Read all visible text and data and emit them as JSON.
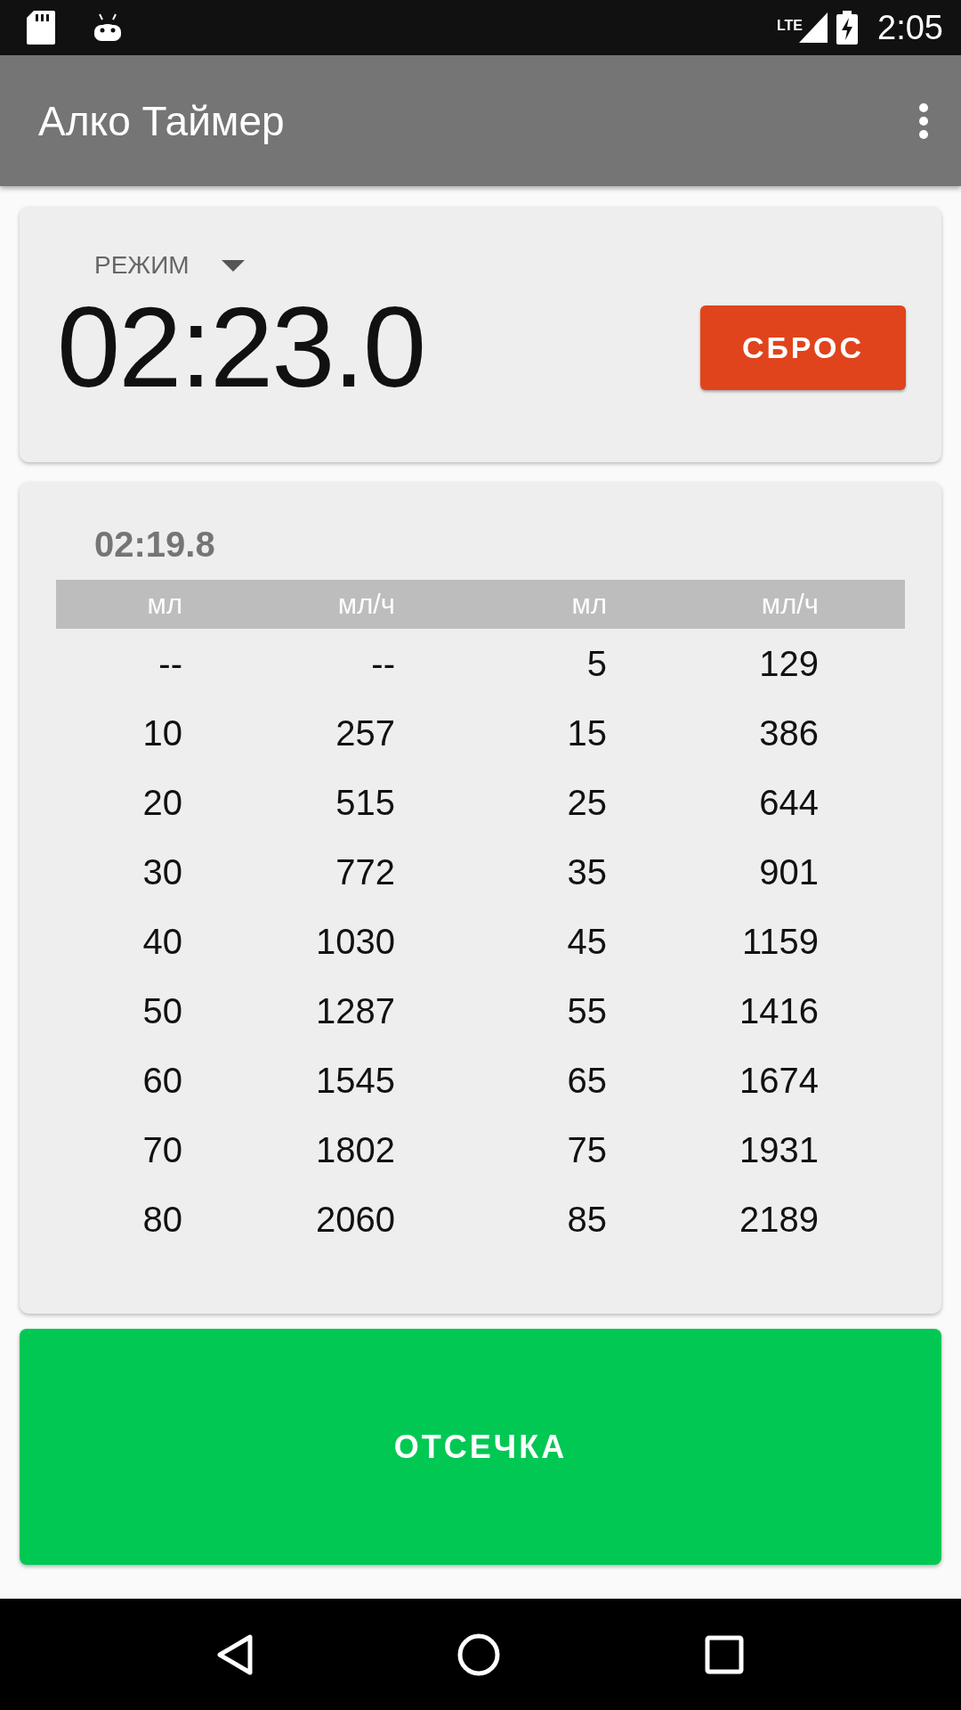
{
  "status_bar": {
    "time": "2:05",
    "network": "LTE"
  },
  "app_bar": {
    "title": "Алко Таймер"
  },
  "timer_card": {
    "mode_label": "РЕЖИМ",
    "time": "02:23.0",
    "reset_button": "СБРОС"
  },
  "table_card": {
    "last_time": "02:19.8",
    "columns": [
      "мл",
      "мл/ч",
      "мл",
      "мл/ч"
    ],
    "rows": [
      [
        "--",
        "--",
        "5",
        "129"
      ],
      [
        "10",
        "257",
        "15",
        "386"
      ],
      [
        "20",
        "515",
        "25",
        "644"
      ],
      [
        "30",
        "772",
        "35",
        "901"
      ],
      [
        "40",
        "1030",
        "45",
        "1159"
      ],
      [
        "50",
        "1287",
        "55",
        "1416"
      ],
      [
        "60",
        "1545",
        "65",
        "1674"
      ],
      [
        "70",
        "1802",
        "75",
        "1931"
      ],
      [
        "80",
        "2060",
        "85",
        "2189"
      ]
    ]
  },
  "cutoff_button": "ОТСЕЧКА"
}
